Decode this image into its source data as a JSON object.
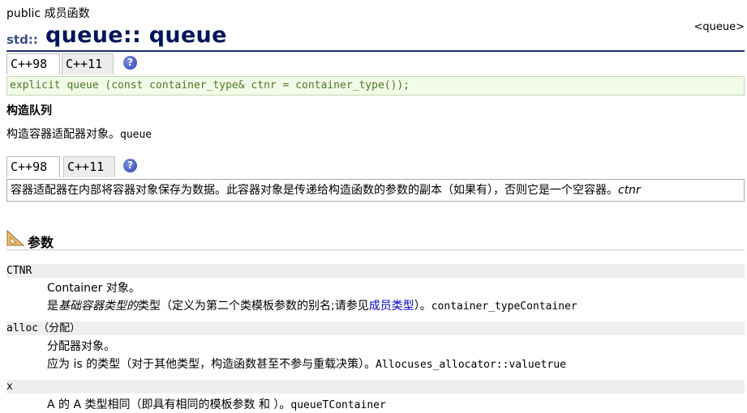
{
  "page": {
    "member_type": "public 成员函数",
    "title_ns": "std::",
    "title_main": "queue:: queue",
    "header_link": "<queue>"
  },
  "tabs_top": {
    "tab1": "C++98",
    "tab2": "C++11",
    "help": "?"
  },
  "code": "explicit queue (const container_type& ctnr = container_type());",
  "subheading": "构造队列",
  "description": {
    "text": "构造容器适配器对象。",
    "code": "queue"
  },
  "tabs_mid": {
    "tab1": "C++98",
    "tab2": "C++11",
    "help": "?"
  },
  "info": {
    "text": "容器适配器在内部将容器对象保存为数据。此容器对象是传递给构造函数的参数的副本（如果有），否则它是一个空容器。",
    "ital": "ctnr"
  },
  "params_section": {
    "title": "参数"
  },
  "params": [
    {
      "name": "CTNR",
      "line1": "Container 对象。",
      "line2": {
        "a": "是",
        "b": "基础容器类型的",
        "c": "类型（定义为第二个类模板参数的别名;请参见",
        "link": "成员类型",
        "d": "）。",
        "code": "container_typeContainer"
      }
    },
    {
      "name": "alloc",
      "name_suffix": "（分配）",
      "line1": "分配器对象。",
      "line2": {
        "a": "应为 is 的类型（对于其他类型，构造函数甚至不参与重载决策）。",
        "code": "Allocuses_allocator::valuetrue"
      }
    },
    {
      "name": "x",
      "line1": {
        "a": "A 的 A 类型相同（即具有相同的模板参数 和 ）。",
        "code": "queueTContainer"
      }
    }
  ],
  "colors": {
    "title": "#00165c",
    "code_text": "#4c7a24",
    "code_bg": "#f2fbe8",
    "link": "#0000cc",
    "rule": "#1c2f6e"
  }
}
